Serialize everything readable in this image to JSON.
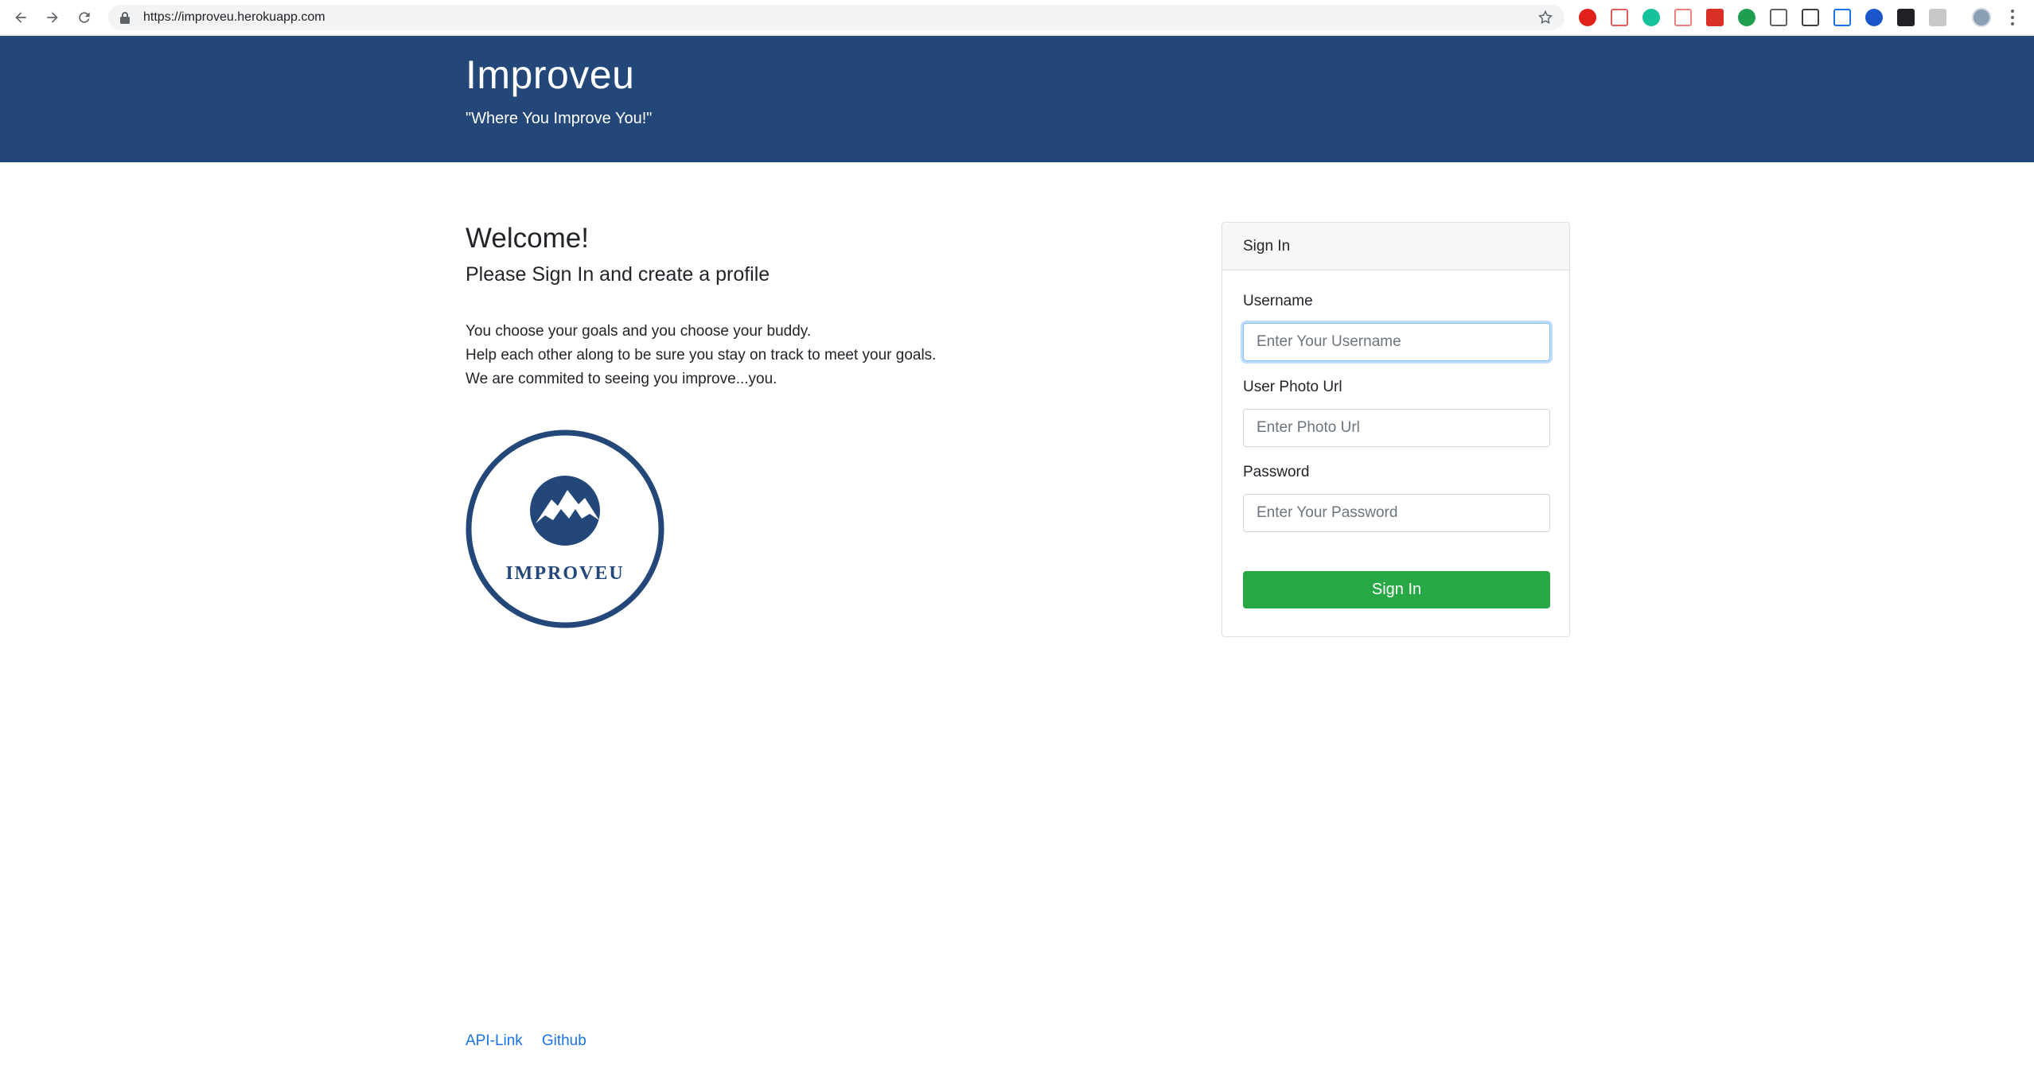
{
  "browser": {
    "url": "https://improveu.herokuapp.com"
  },
  "header": {
    "title": "Improveu",
    "tagline": "\"Where You Improve You!\""
  },
  "main": {
    "welcome": "Welcome!",
    "subheading": "Please Sign In and create a profile",
    "blurb": [
      "You choose your goals and you choose your buddy.",
      "Help each other along to be sure you stay on track to meet your goals.",
      "We are commited to seeing you improve...you."
    ],
    "logo_text": "IMPROVEU"
  },
  "signin_card": {
    "header": "Sign In",
    "username_label": "Username",
    "username_placeholder": "Enter Your Username",
    "photo_label": "User Photo Url",
    "photo_placeholder": "Enter Photo Url",
    "password_label": "Password",
    "password_placeholder": "Enter Your Password",
    "submit_label": "Sign In"
  },
  "footer": {
    "links": [
      "API-Link",
      "Github"
    ]
  },
  "colors": {
    "brand": "#24477a",
    "success": "#28a745",
    "link": "#1a73e8"
  }
}
